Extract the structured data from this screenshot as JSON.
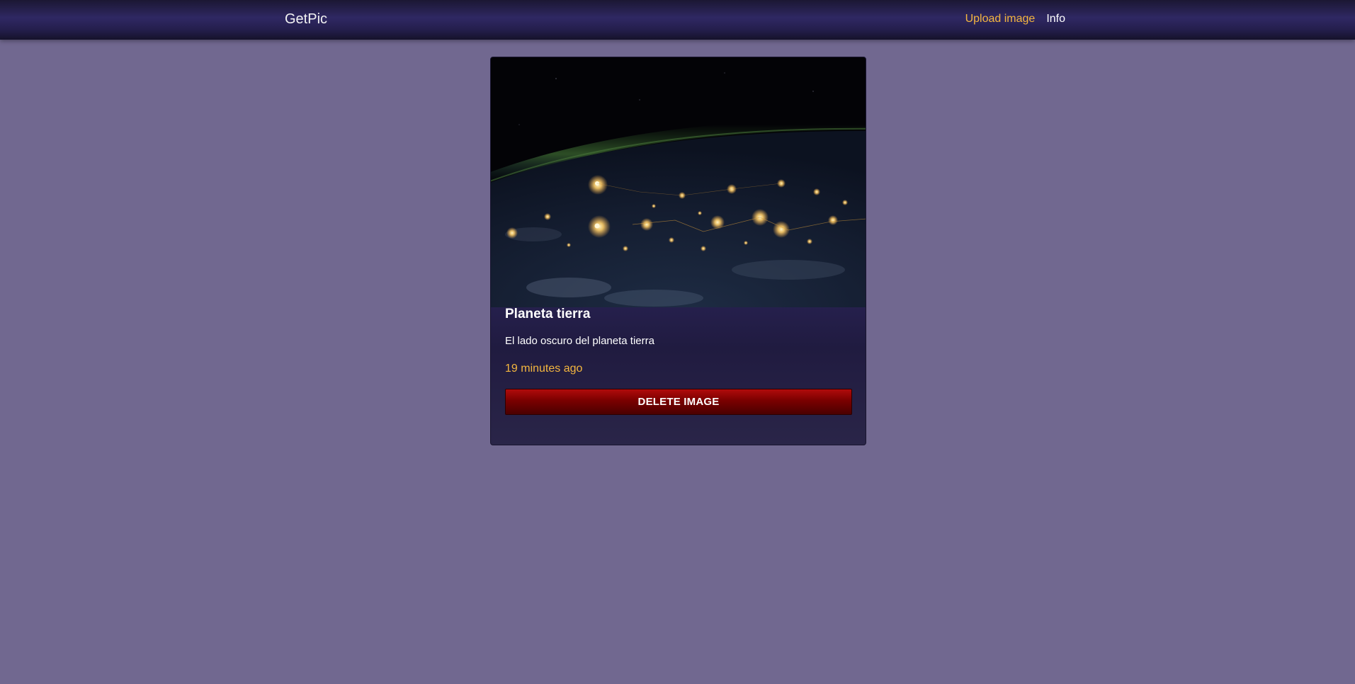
{
  "navbar": {
    "brand": "GetPic",
    "links": [
      {
        "label": "Upload image",
        "active": true
      },
      {
        "label": "Info",
        "active": false
      }
    ]
  },
  "card": {
    "image_alt": "Planeta tierra",
    "title": "Planeta tierra",
    "description": "El lado oscuro del planeta tierra",
    "timestamp": "19 minutes ago",
    "delete_label": "DELETE IMAGE"
  },
  "colors": {
    "background": "#716890",
    "accent": "#f4b63f",
    "danger": "#8b0000"
  }
}
